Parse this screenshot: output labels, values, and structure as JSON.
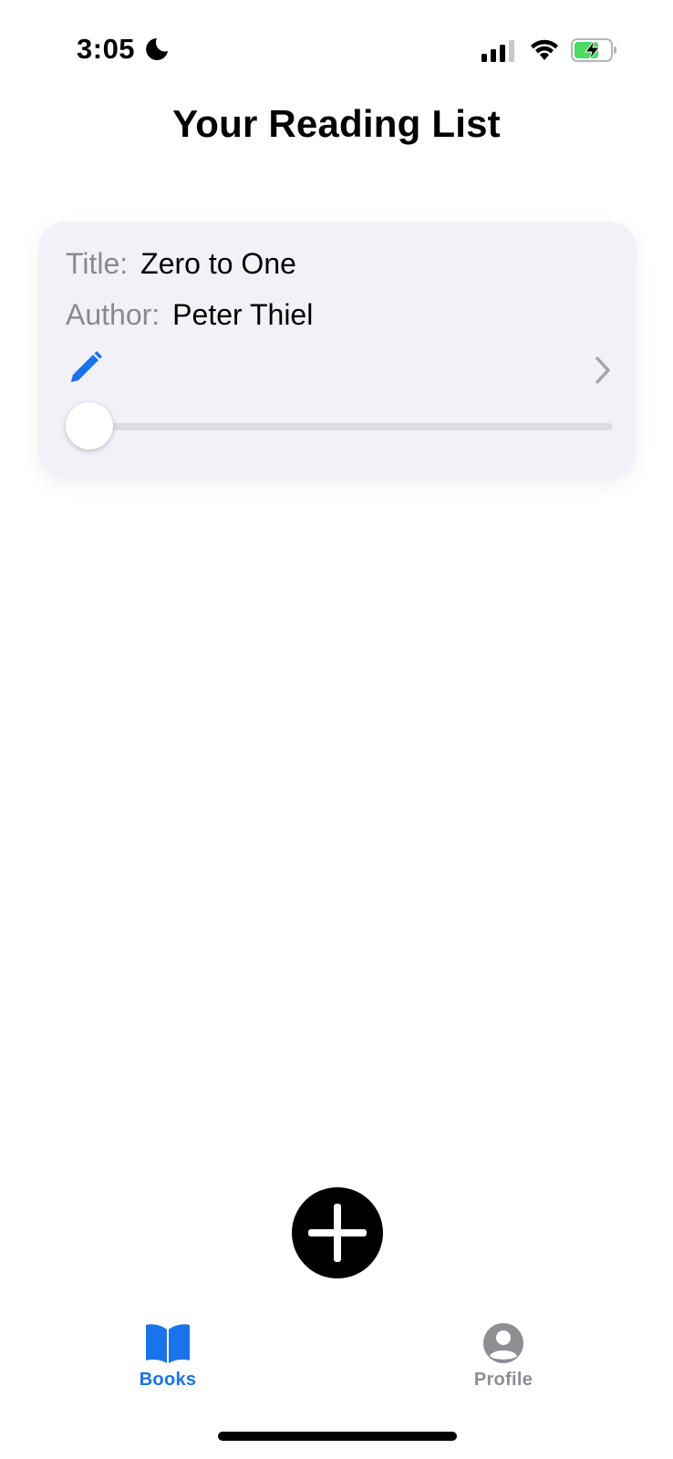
{
  "status_bar": {
    "time": "3:05",
    "icons": [
      "moon-icon",
      "cellular-signal-icon",
      "wifi-icon",
      "battery-charging-icon"
    ],
    "battery_color": "#4cd964"
  },
  "header": {
    "title": "Your Reading List"
  },
  "books": [
    {
      "title_label": "Title:",
      "title": "Zero to One",
      "author_label": "Author:",
      "author": "Peter Thiel",
      "progress": 0,
      "icons": [
        "pencil-icon",
        "chevron-right-icon"
      ]
    }
  ],
  "add_button": {
    "icon": "plus-icon"
  },
  "tab_bar": {
    "tabs": [
      {
        "label": "Books",
        "icon": "book-icon",
        "selected": true
      },
      {
        "label": "Profile",
        "icon": "person-circle-icon",
        "selected": false
      }
    ]
  },
  "colors": {
    "accent": "#1a73e8",
    "card_background": "#f1f1f7",
    "secondary_text": "#8a8a8e",
    "inactive_tab": "#8e8e93"
  }
}
